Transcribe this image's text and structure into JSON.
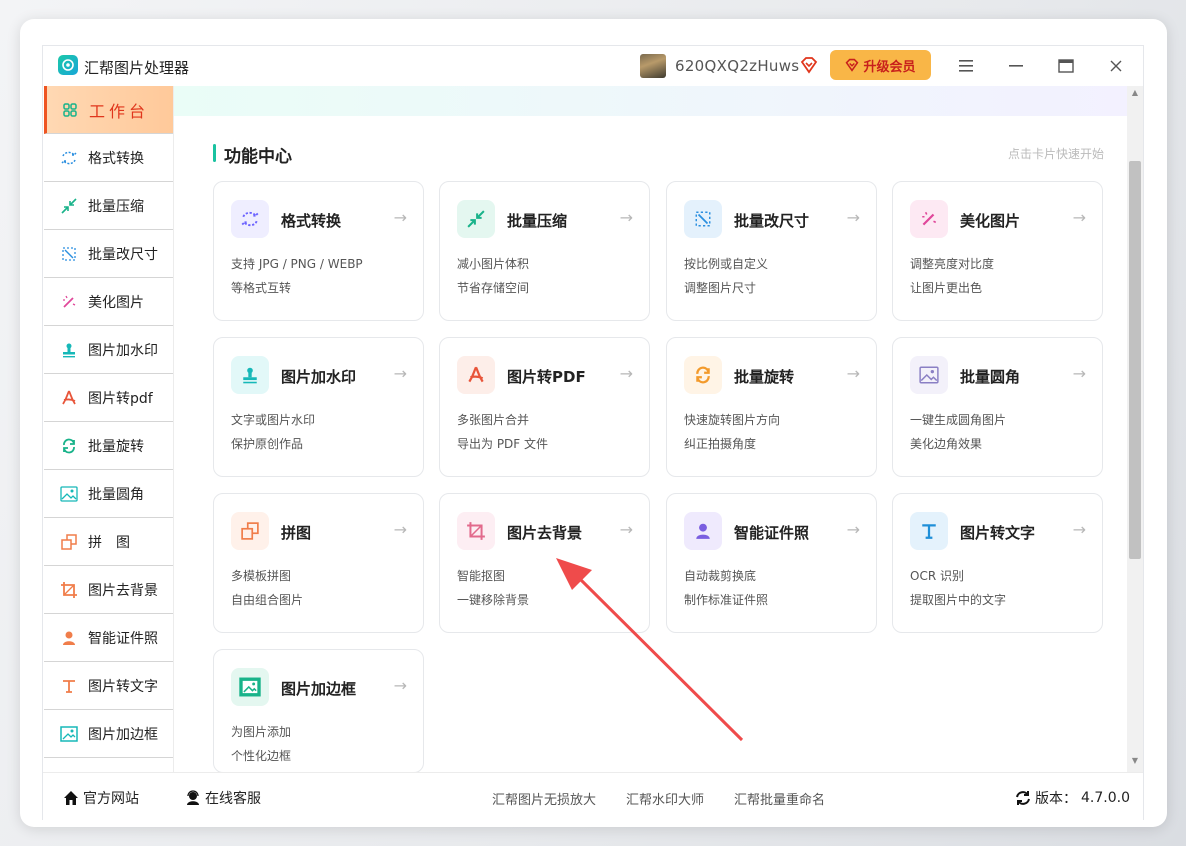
{
  "app": {
    "title": "汇帮图片处理器",
    "username": "620QXQ2zHuws",
    "upgrade_label": "升级会员"
  },
  "sidebar": {
    "items": [
      {
        "label": "工作台",
        "icon": "grid-icon",
        "active": true
      },
      {
        "label": "格式转换",
        "icon": "convert-icon"
      },
      {
        "label": "批量压缩",
        "icon": "compress-icon"
      },
      {
        "label": "批量改尺寸",
        "icon": "resize-icon"
      },
      {
        "label": "美化图片",
        "icon": "magic-wand-icon"
      },
      {
        "label": "图片加水印",
        "icon": "stamp-icon"
      },
      {
        "label": "图片转pdf",
        "icon": "pdf-icon"
      },
      {
        "label": "批量旋转",
        "icon": "rotate-icon"
      },
      {
        "label": "批量圆角",
        "icon": "rounded-image-icon"
      },
      {
        "label": "拼　图",
        "icon": "collage-icon"
      },
      {
        "label": "图片去背景",
        "icon": "crop-icon"
      },
      {
        "label": "智能证件照",
        "icon": "person-icon"
      },
      {
        "label": "图片转文字",
        "icon": "text-icon"
      },
      {
        "label": "图片加边框",
        "icon": "frame-icon"
      }
    ]
  },
  "main": {
    "section_title": "功能中心",
    "section_hint": "点击卡片快速开始",
    "arrow": "→",
    "cards": [
      {
        "title": "格式转换",
        "desc1": "支持 JPG / PNG / WEBP",
        "desc2": "等格式互转",
        "icon": "convert-icon",
        "color": "#6c63ff",
        "bg": "#efeeff"
      },
      {
        "title": "批量压缩",
        "desc1": "减小图片体积",
        "desc2": "节省存储空间",
        "icon": "compress-icon",
        "color": "#19b38a",
        "bg": "#e4f7f0"
      },
      {
        "title": "批量改尺寸",
        "desc1": "按比例或自定义",
        "desc2": "调整图片尺寸",
        "icon": "resize-icon",
        "color": "#2b8fe0",
        "bg": "#e4f1fc"
      },
      {
        "title": "美化图片",
        "desc1": "调整亮度对比度",
        "desc2": "让图片更出色",
        "icon": "magic-wand-icon",
        "color": "#e0479a",
        "bg": "#fde9f3"
      },
      {
        "title": "图片加水印",
        "desc1": "文字或图片水印",
        "desc2": "保护原创作品",
        "icon": "stamp-icon",
        "color": "#16b8b8",
        "bg": "#e2f8f8"
      },
      {
        "title": "图片转PDF",
        "desc1": "多张图片合并",
        "desc2": "导出为 PDF 文件",
        "icon": "pdf-icon",
        "color": "#e8553a",
        "bg": "#fdeee9"
      },
      {
        "title": "批量旋转",
        "desc1": "快速旋转图片方向",
        "desc2": "纠正拍摄角度",
        "icon": "rotate-icon",
        "color": "#f39a2b",
        "bg": "#fff4e6"
      },
      {
        "title": "批量圆角",
        "desc1": "一键生成圆角图片",
        "desc2": "美化边角效果",
        "icon": "rounded-image-icon",
        "color": "#8a7fc4",
        "bg": "#f3f1fa"
      },
      {
        "title": "拼图",
        "desc1": "多模板拼图",
        "desc2": "自由组合图片",
        "icon": "collage-icon",
        "color": "#f07d4a",
        "bg": "#fff1ea"
      },
      {
        "title": "图片去背景",
        "desc1": "智能抠图",
        "desc2": "一键移除背景",
        "icon": "crop-icon",
        "color": "#e26a8c",
        "bg": "#fdeef3"
      },
      {
        "title": "智能证件照",
        "desc1": "自动裁剪换底",
        "desc2": "制作标准证件照",
        "icon": "person-icon",
        "color": "#7a5ee0",
        "bg": "#efeafd"
      },
      {
        "title": "图片转文字",
        "desc1": "OCR 识别",
        "desc2": "提取图片中的文字",
        "icon": "text-icon",
        "color": "#1f8fd8",
        "bg": "#e4f2fc"
      },
      {
        "title": "图片加边框",
        "desc1": "为图片添加",
        "desc2": "个性化边框",
        "icon": "frame-icon",
        "color": "#19b38a",
        "bg": "#e4f7f0"
      }
    ]
  },
  "footer": {
    "official_site": "官方网站",
    "online_service": "在线客服",
    "links": [
      "汇帮图片无损放大",
      "汇帮水印大师",
      "汇帮批量重命名"
    ],
    "version_label": "版本：",
    "version": "4.7.0.0"
  }
}
